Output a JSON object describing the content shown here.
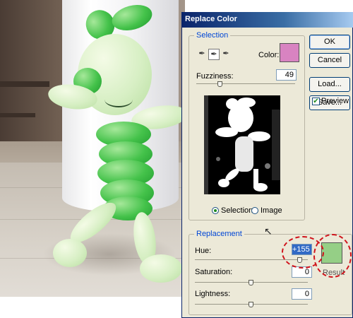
{
  "dialog": {
    "title": "Replace Color",
    "buttons": {
      "ok": "OK",
      "cancel": "Cancel",
      "load": "Load...",
      "save": "Save..."
    },
    "preview": {
      "label": "Preview",
      "checked": true
    }
  },
  "selection": {
    "group_label": "Selection",
    "color_label": "Color:",
    "color_value": "#d883c1",
    "fuzziness_label": "Fuzziness:",
    "fuzziness_value": "49",
    "fuzziness_fraction": 0.245,
    "view_options": [
      {
        "label": "Selection",
        "selected": true
      },
      {
        "label": "Image",
        "selected": false
      }
    ]
  },
  "replacement": {
    "group_label": "Replacement",
    "hue_label": "Hue:",
    "hue_value": "+155",
    "hue_fraction": 0.93,
    "saturation_label": "Saturation:",
    "saturation_value": "0",
    "saturation_fraction": 0.5,
    "lightness_label": "Lightness:",
    "lightness_value": "0",
    "lightness_fraction": 0.5,
    "result_label": "Result",
    "result_color": "#95cf86"
  },
  "colors": {
    "title_bar": "#0a246a",
    "annotation": "#d0141c"
  }
}
